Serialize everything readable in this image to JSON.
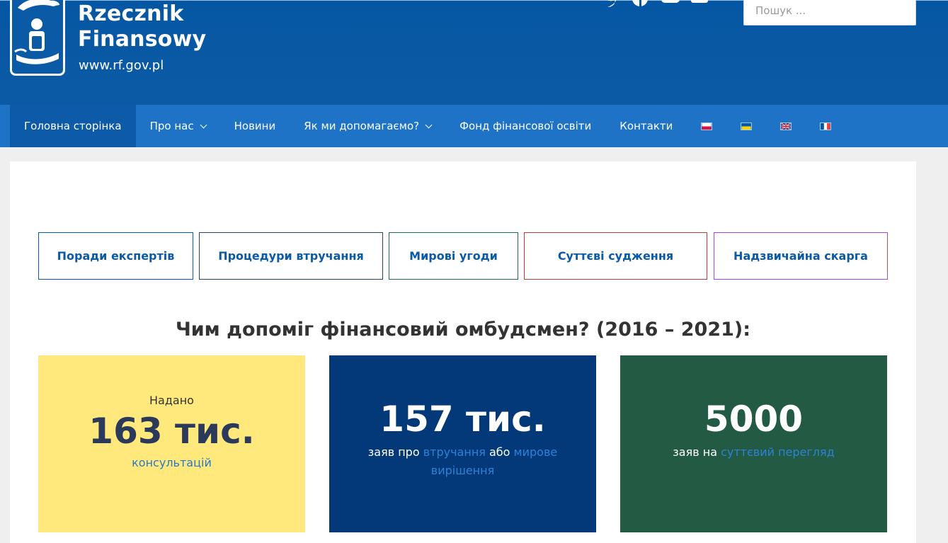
{
  "brand": {
    "name_line1": "Rzecznik",
    "name_line2": "Finansowy",
    "url": "www.rf.gov.pl",
    "logo_icon": "helping-hands-person-icon",
    "primary_color": "#0657a3",
    "nav_color": "#1e73c6"
  },
  "social": [
    "twitter-icon",
    "facebook-icon",
    "youtube-icon",
    "linkedin-icon"
  ],
  "search": {
    "placeholder": "Пошук ..."
  },
  "nav": {
    "items": [
      {
        "label": "Головна сторінка",
        "active": true
      },
      {
        "label": "Про нас",
        "dropdown": true
      },
      {
        "label": "Новини"
      },
      {
        "label": "Як ми допомагаємо?",
        "dropdown": true
      },
      {
        "label": "Фонд фінансової освіти"
      },
      {
        "label": "Контакти"
      }
    ],
    "languages": [
      "flag-pl-icon",
      "flag-ua-icon",
      "flag-gb-icon",
      "flag-fr-icon"
    ]
  },
  "quick_links": [
    {
      "label": "Поради експертів",
      "border": "#0b5aa6"
    },
    {
      "label": "Процедури втручання",
      "border": "#23436c"
    },
    {
      "label": "Мирові угоди",
      "border": "#1d6b57"
    },
    {
      "label": "Суттєві судження",
      "border": "#c23b3b"
    },
    {
      "label": "Надзвичайна скарга",
      "border": "#9b4bd3"
    }
  ],
  "stats_heading": "Чим допоміг фінансовий омбудсмен? (2016 – 2021):",
  "stats": [
    {
      "pre": "Надано",
      "value": "163 тис.",
      "desc_link": "консультацій",
      "bg": "#ffe97c",
      "color": "#2b3a5b"
    },
    {
      "value": "157 тис.",
      "desc_before": "заяв про ",
      "link1": "втручання",
      "mid": " або ",
      "link2": "мирове вирішення",
      "bg": "#033978",
      "color": "#ffffff"
    },
    {
      "value": "5000",
      "desc_before": "заяв на ",
      "link1": "суттєвий перегляд",
      "bg": "#235a44",
      "color": "#ffffff"
    }
  ]
}
